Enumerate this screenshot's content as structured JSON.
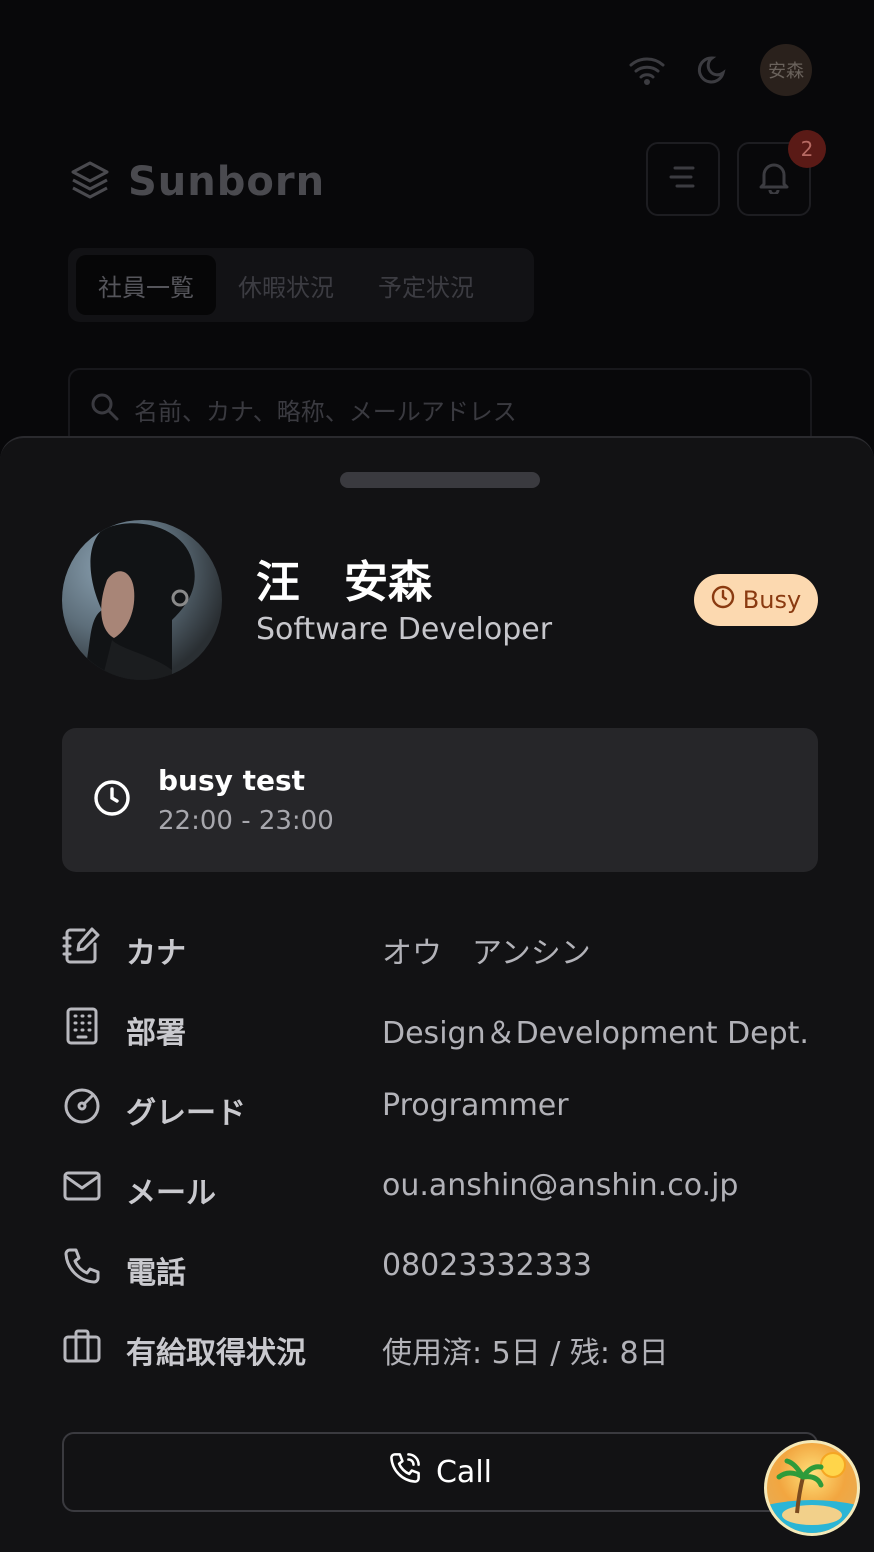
{
  "header": {
    "avatar_text": "安森",
    "brand_name": "Sunborn",
    "notification_count": "2"
  },
  "tabs": [
    {
      "label": "社員一覧",
      "active": true
    },
    {
      "label": "休暇状況",
      "active": false
    },
    {
      "label": "予定状況",
      "active": false
    }
  ],
  "search": {
    "placeholder": "名前、カナ、略称、メールアドレス"
  },
  "profile": {
    "name": "汪　安森",
    "role": "Software Developer",
    "status_label": "Busy"
  },
  "event": {
    "title": "busy test",
    "time": "22:00 - 23:00"
  },
  "details": [
    {
      "icon": "notebook-pen-icon",
      "label": "カナ",
      "value": "オウ　アンシン"
    },
    {
      "icon": "building-icon",
      "label": "部署",
      "value": "Design＆Development Dept."
    },
    {
      "icon": "gauge-icon",
      "label": "グレード",
      "value": "Programmer"
    },
    {
      "icon": "mail-icon",
      "label": "メール",
      "value": "ou.anshin@anshin.co.jp"
    },
    {
      "icon": "phone-icon",
      "label": "電話",
      "value": "08023332333"
    },
    {
      "icon": "briefcase-icon",
      "label": "有給取得状況",
      "value": "使用済: 5日 / 残: 8日"
    }
  ],
  "call_button": {
    "label": "Call"
  },
  "colors": {
    "sheet_bg": "#121214",
    "status_bg": "#fcd9b0",
    "status_text": "#8a3a10",
    "event_bg": "#262629"
  }
}
